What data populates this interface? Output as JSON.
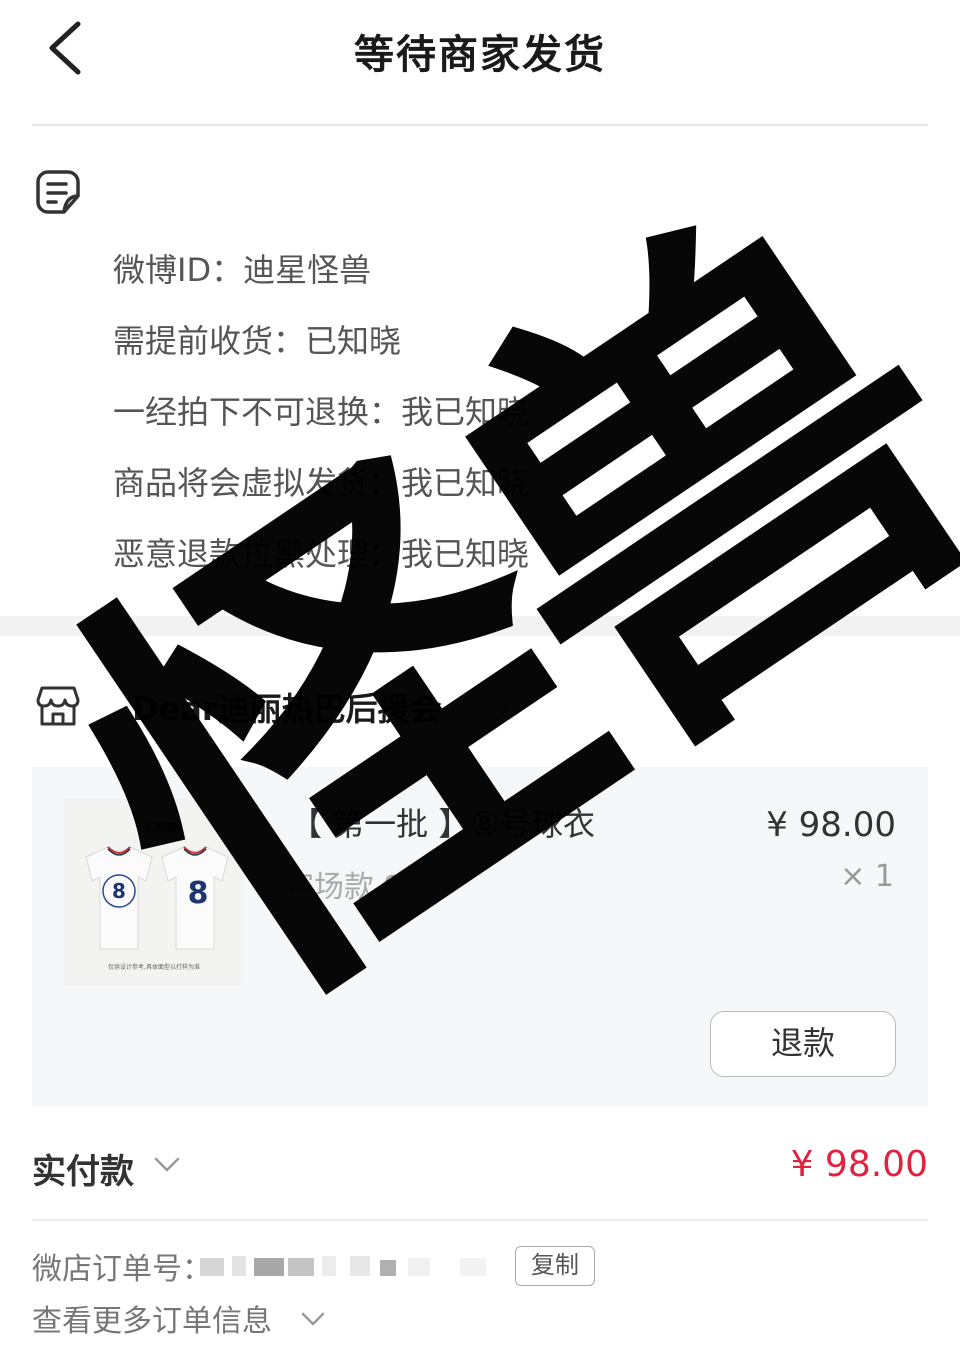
{
  "header": {
    "title": "等待商家发货"
  },
  "notes": [
    {
      "label": "微博ID",
      "value": "迪星怪兽"
    },
    {
      "label": "需提前收货",
      "value": "已知晓"
    },
    {
      "label": "一经拍下不可退换",
      "value": "我已知晓"
    },
    {
      "label": "商品将会虚拟发货",
      "value": "我已知晓"
    },
    {
      "label": "恶意退款拉黑处理",
      "value": "我已知晓"
    }
  ],
  "note_separator": "：",
  "shop": {
    "name": "Dear迪丽热巴后援会"
  },
  "product": {
    "title": "【 第一批 】⑧号球衣",
    "variant": "客场款,S",
    "price": "¥ 98.00",
    "quantity": "× 1",
    "thumb_tag": "客场款】",
    "thumb_caption": "仅供设计参考,具体面型以打样为准",
    "thumb_number": "8",
    "refund_label": "退款"
  },
  "payment": {
    "label": "实付款",
    "amount": "¥ 98.00"
  },
  "order": {
    "label": "微店订单号：",
    "copy_label": "复制",
    "more_label": "查看更多订单信息"
  },
  "watermark": {
    "text": "怪兽"
  },
  "colors": {
    "price_red": "#e0223f",
    "card_bg": "#f6f7f9",
    "band_bg": "#f2f2f2"
  }
}
